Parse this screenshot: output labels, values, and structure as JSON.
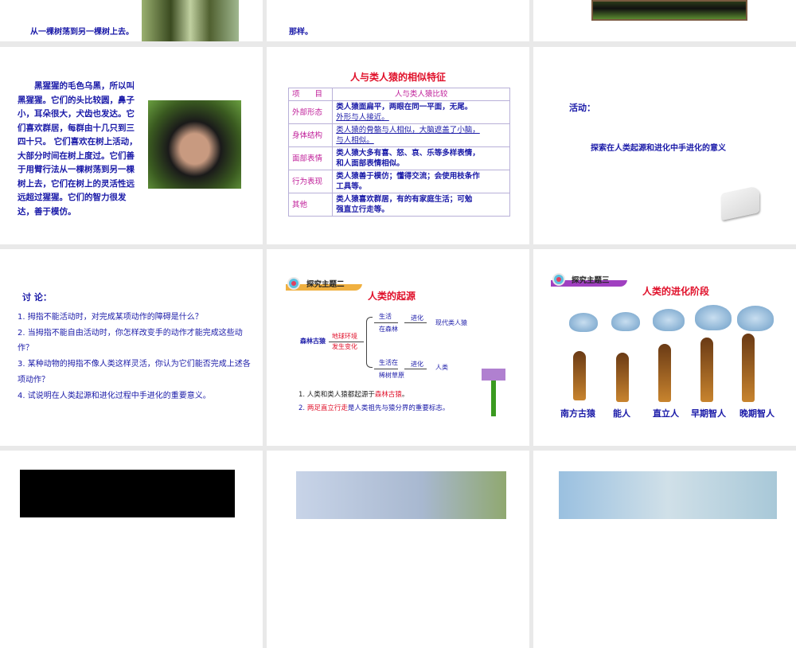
{
  "slides": {
    "s0a": {
      "tail": "从一棵树荡到另一棵树上去。"
    },
    "s0b": {
      "tail": "那样。"
    },
    "s1a": {
      "text": "黑猩猩的毛色乌黑，所以叫黑猩猩。它们的头比较圆，鼻子小，耳朵很大，犬齿也发达。它们喜欢群居，每群由十几只到三四十只。 它们喜欢在树上活动，大部分时间在树上度过。它们善于用臂行法从一棵树荡到另一棵树上去，它们在树上的灵活性远远超过猩猩。它们的智力很发达，善于模仿。"
    },
    "s1b": {
      "title": "人与类人猿的相似特征",
      "head": [
        "项　　目",
        "人与类人猿比较"
      ],
      "rows": [
        {
          "k": "外部形态",
          "v1": "类人猿面扁平，两眼在同一平面，无尾。",
          "v2": "外形与人接近。"
        },
        {
          "k": "身体结构",
          "v1": "类人猿的骨骼与人相似，大脑遮盖了小脑，",
          "v2": "与人相似。"
        },
        {
          "k": "面部表情",
          "v1": "类人猿大多有喜、怒、哀、乐等多样表情，",
          "v2": "和人面部表情相似。"
        },
        {
          "k": "行为表现",
          "v1": "类人猿善于模仿；懂得交流；会使用枝条作",
          "v2": "工具等。"
        },
        {
          "k": "其他",
          "v1": "类人猿喜欢群居，有的有家庭生活；可勉",
          "v2": "强直立行走等。"
        }
      ]
    },
    "s1c": {
      "label": "活动：",
      "text": "探索在人类起源和进化中手进化的意义"
    },
    "s2a": {
      "title": "讨 论：",
      "items": [
        "1. 拇指不能活动时，对完成某项动作的障碍是什么？",
        "2. 当拇指不能自由活动时，你怎样改变手的动作才能完成这些动作？",
        "3. 某种动物的拇指不像人类这样灵活，你认为它们能否完成上述各项动作？",
        "4. 试说明在人类起源和进化过程中手进化的重要意义。"
      ]
    },
    "s2b": {
      "badge": "探究主题二",
      "title": "人类的起源",
      "start": "森林古猿",
      "cause1": "地球环境",
      "cause2": "发生变化",
      "up1": "生活",
      "up2": "在森林",
      "upEvo": "进化",
      "upRes": "现代类人猿",
      "dn1": "生活在",
      "dn2": "稀树草原",
      "dnEvo": "进化",
      "dnRes": "人类",
      "n1a": "1. 人类和类人猿都起源于",
      "n1b": "森林古猿",
      "n1c": "。",
      "n2a": "2. ",
      "n2b": "两足直立行走",
      "n2c": "是人类祖先与猿分界的重要标志。"
    },
    "s2c": {
      "badge": "探究主题三",
      "title": "人类的进化阶段",
      "stages": [
        "南方古猿",
        "能人",
        "直立人",
        "早期智人",
        "晚期智人"
      ]
    }
  }
}
